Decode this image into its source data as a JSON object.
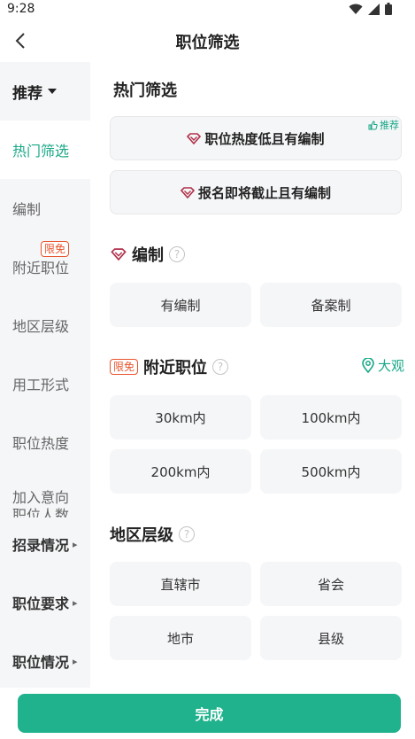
{
  "status": {
    "time": "9:28"
  },
  "nav": {
    "title": "职位筛选"
  },
  "sidebar": {
    "header": "推荐",
    "items": [
      {
        "label": "热门筛选"
      },
      {
        "label": "编制"
      },
      {
        "label": "附近职位",
        "badge": "限免"
      },
      {
        "label": "地区层级"
      },
      {
        "label": "用工形式"
      },
      {
        "label": "职位热度"
      },
      {
        "label": "加入意向职位人数"
      },
      {
        "label": "招录情况"
      },
      {
        "label": "职位要求"
      },
      {
        "label": "职位情况"
      }
    ]
  },
  "hot": {
    "title": "热门筛选",
    "recommend_tag": "推荐",
    "cards": [
      "职位热度低且有编制",
      "报名即将截止且有编制"
    ]
  },
  "bianzhi": {
    "title": "编制",
    "help": "?",
    "options": [
      "有编制",
      "备案制"
    ]
  },
  "nearby": {
    "badge": "限免",
    "title": "附近职位",
    "help": "?",
    "location": "大观",
    "options": [
      "30km内",
      "100km内",
      "200km内",
      "500km内"
    ]
  },
  "region": {
    "title": "地区层级",
    "help": "?",
    "options": [
      "直辖市",
      "省会",
      "地市",
      "县级"
    ]
  },
  "footer": {
    "done": "完成"
  },
  "colors": {
    "accent": "#1fb28c",
    "limited": "#e8532c",
    "diamond": "#b0314a"
  }
}
